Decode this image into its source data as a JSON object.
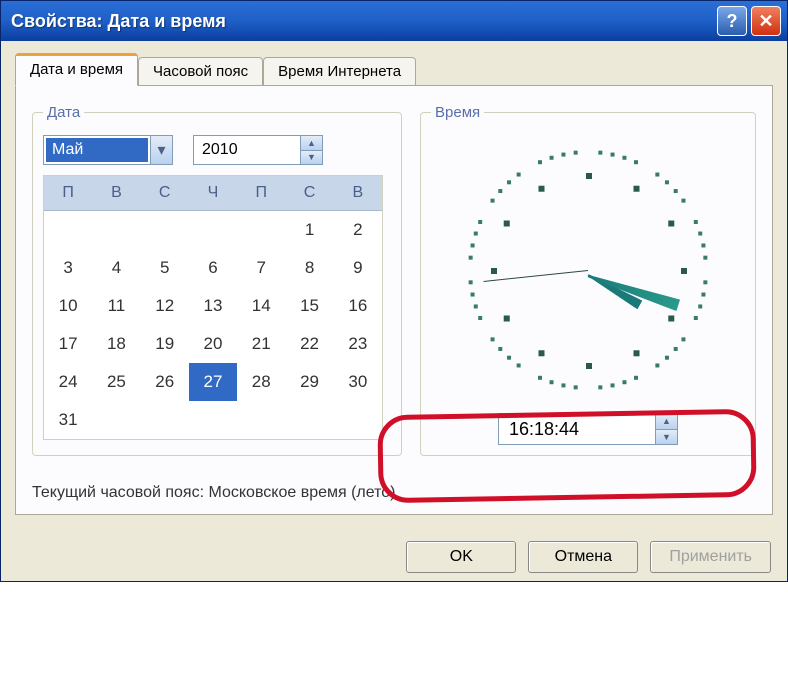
{
  "window": {
    "title": "Свойства: Дата и время"
  },
  "tabs": [
    {
      "label": "Дата и время",
      "active": true
    },
    {
      "label": "Часовой пояс",
      "active": false
    },
    {
      "label": "Время Интернета",
      "active": false
    }
  ],
  "date_group": {
    "legend": "Дата",
    "month": "Май",
    "year": "2010",
    "weekday_headers": [
      "П",
      "В",
      "С",
      "Ч",
      "П",
      "С",
      "В"
    ],
    "selected_day": 27,
    "grid": [
      [
        0,
        0,
        0,
        0,
        0,
        1,
        2
      ],
      [
        3,
        4,
        5,
        6,
        7,
        8,
        9
      ],
      [
        10,
        11,
        12,
        13,
        14,
        15,
        16
      ],
      [
        17,
        18,
        19,
        20,
        21,
        22,
        23
      ],
      [
        24,
        25,
        26,
        27,
        28,
        29,
        30
      ],
      [
        31,
        0,
        0,
        0,
        0,
        0,
        0
      ]
    ]
  },
  "time_group": {
    "legend": "Время",
    "value": "16:18:44"
  },
  "timezone_text": "Текущий часовой пояс: Московское время (лето)",
  "buttons": {
    "ok": "OK",
    "cancel": "Отмена",
    "apply": "Применить"
  }
}
